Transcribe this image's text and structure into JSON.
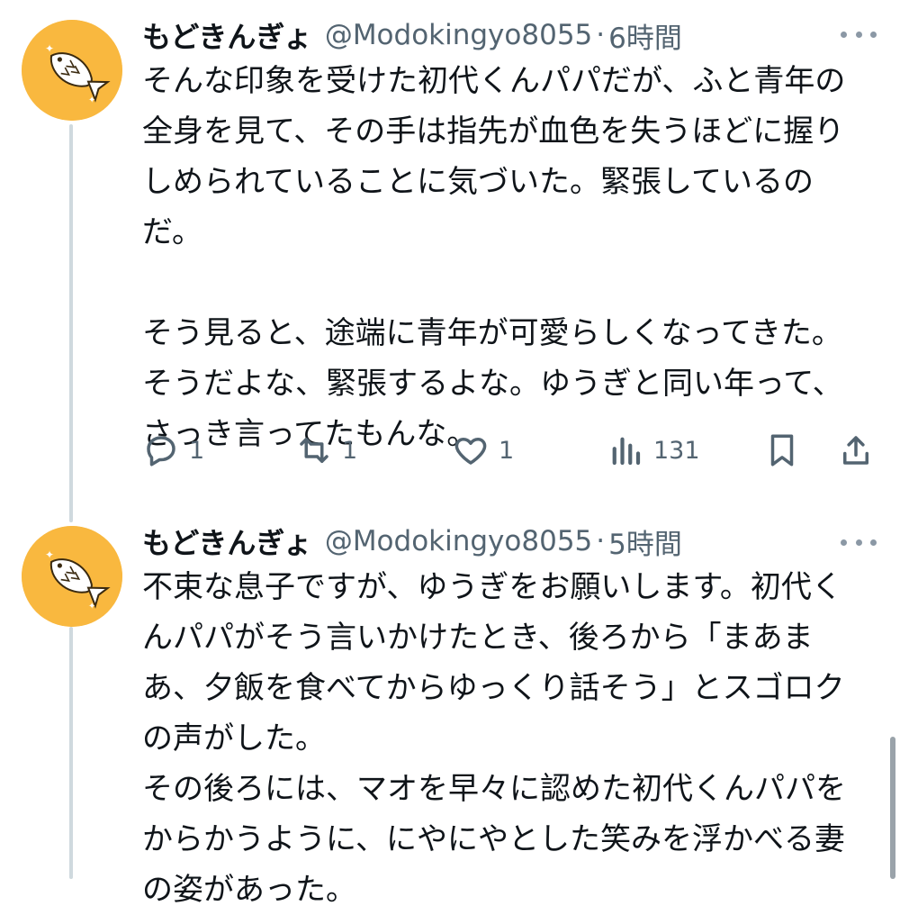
{
  "tweets": [
    {
      "display_name": "もどきんぎょ",
      "handle": "@Modokingyo8055",
      "separator": "·",
      "time": "6時間",
      "paragraphs": [
        "そんな印象を受けた初代くんパパだが、ふと青年の全身を見て、その手は指先が血色を失うほどに握りしめられていることに気づいた。緊張しているのだ。",
        "そう見ると、途端に青年が可愛らしくなってきた。そうだよな、緊張するよな。ゆうぎと同い年って、さっき言ってたもんな。"
      ],
      "actions": {
        "reply_count": "1",
        "retweet_count": "1",
        "like_count": "1",
        "view_count": "131"
      }
    },
    {
      "display_name": "もどきんぎょ",
      "handle": "@Modokingyo8055",
      "separator": "·",
      "time": "5時間",
      "paragraphs": [
        "不束な息子ですが、ゆうぎをお願いします。初代くんパパがそう言いかけたとき、後ろから「まあまあ、夕飯を食べてからゆっくり話そう」とスゴロクの声がした。",
        "その後ろには、マオを早々に認めた初代くんパパをからかうように、にやにやとした笑みを浮かべる妻の姿があった。"
      ]
    }
  ],
  "icons": {
    "avatar": "goldfish-avatar",
    "more": "more-icon",
    "reply": "reply-icon",
    "retweet": "retweet-icon",
    "like": "heart-icon",
    "views": "views-icon",
    "bookmark": "bookmark-icon",
    "share": "share-icon"
  },
  "colors": {
    "avatar_bg": "#f9b83f",
    "text": "#0f1419",
    "muted": "#536471",
    "thread_line": "#cfd9de"
  }
}
